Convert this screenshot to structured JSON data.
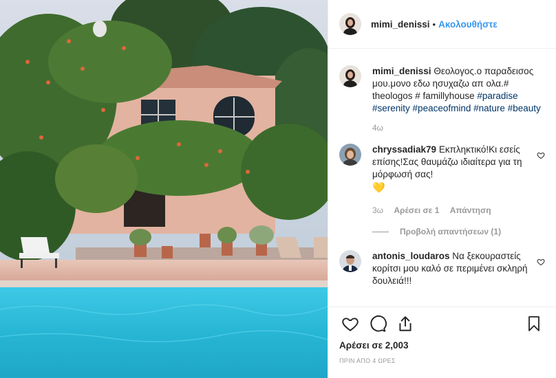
{
  "post": {
    "username": "mimi_denissi",
    "follow_label": "Ακολουθήστε",
    "dot": "•"
  },
  "caption": {
    "username": "mimi_denissi",
    "text": "Θεολογος.ο παραδεισος μου.μονο εδω ησυχαζω απ ολα.# theologos # famillyhouse",
    "hashtags": [
      "#paradise",
      "#serenity",
      "#peaceofmind",
      "#nature",
      "#beauty"
    ],
    "time": "4ω"
  },
  "comments": [
    {
      "username": "chryssadiak79",
      "text": "Εκπληκτικό!Κι εσείς επίσης!Σας θαυμάζω ιδιαίτερα για τη μόρφωσή σας!",
      "emoji": "💛",
      "time": "3ω",
      "likes": "Αρέσει σε 1",
      "reply": "Απάντηση",
      "view_replies": "Προβολή απαντήσεων (1)"
    },
    {
      "username": "antonis_loudaros",
      "text": "Να ξεκουραστείς κορίτσι μου καλό σε περιμένει σκληρή δουλειά!!!"
    }
  ],
  "actions": {
    "like_icon": "heart-icon",
    "comment_icon": "comment-icon",
    "share_icon": "share-icon",
    "save_icon": "bookmark-icon"
  },
  "likes_text": "Αρέσει σε 2,003",
  "posted_time": "ΠΡΙΝ ΑΠΟ 4 ΩΡΕΣ",
  "colors": {
    "link": "#3897f0",
    "hashtag": "#003569",
    "pool": "#22b8d6",
    "sky": "#c9d4e2"
  }
}
